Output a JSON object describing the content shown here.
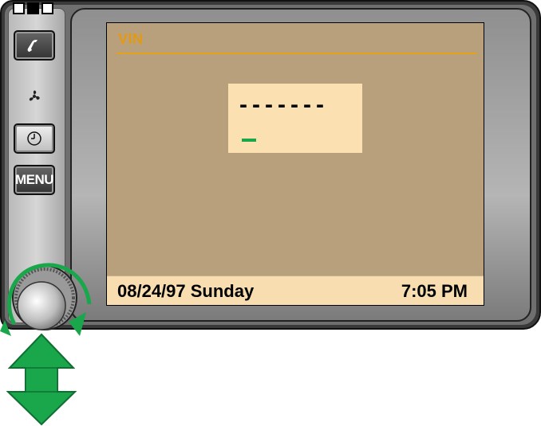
{
  "screen": {
    "title": "VIN",
    "vin_placeholder": "-------",
    "status_date": "08/24/97  Sunday",
    "status_time": "7:05 PM"
  },
  "controls": {
    "menu_label": "MENU",
    "icons": [
      "phone-icon",
      "fan-icon",
      "clock-icon",
      "rotary-knob-icon",
      "rotate-arrows-icon",
      "push-arrow-icon"
    ]
  },
  "colors": {
    "screen_bg": "#b8a07d",
    "vin_box_bg": "#fbe0b2",
    "title_color": "#e39a12",
    "cursor_color": "#1aa64a",
    "arrow_color": "#1aa64a"
  }
}
